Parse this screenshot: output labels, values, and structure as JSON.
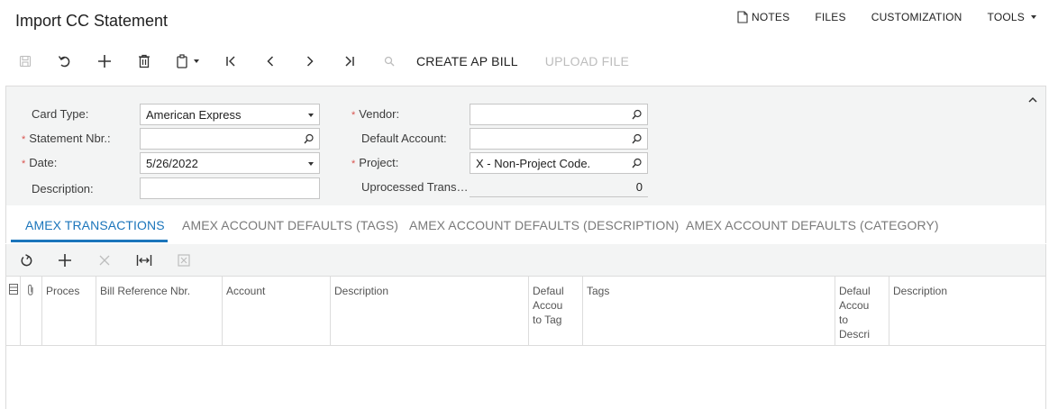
{
  "page": {
    "title": "Import CC Statement"
  },
  "top_menu": {
    "notes": "NOTES",
    "files": "FILES",
    "customization": "CUSTOMIZATION",
    "tools": "TOOLS"
  },
  "toolbar": {
    "icons": [
      "save-icon",
      "undo-icon",
      "add-icon",
      "delete-icon",
      "copy-paste-icon",
      "first-icon",
      "prev-icon",
      "next-icon",
      "last-icon",
      "search-icon"
    ],
    "create_ap_bill": "CREATE AP BILL",
    "upload_file": "UPLOAD FILE"
  },
  "form": {
    "card_type": {
      "label": "Card Type:",
      "value": "American Express"
    },
    "statement_nbr": {
      "label": "Statement Nbr.:",
      "value": ""
    },
    "date": {
      "label": "Date:",
      "value": "5/26/2022"
    },
    "description": {
      "label": "Description:",
      "value": ""
    },
    "vendor": {
      "label": "Vendor:",
      "value": ""
    },
    "default_account": {
      "label": "Default Account:",
      "value": ""
    },
    "project": {
      "label": "Project:",
      "value": "X - Non-Project Code."
    },
    "unprocessed": {
      "label": "Uprocessed Trans…",
      "value": "0"
    },
    "required_mark": "*"
  },
  "tabs": [
    {
      "label": "AMEX TRANSACTIONS",
      "active": true
    },
    {
      "label": "AMEX ACCOUNT DEFAULTS (TAGS)",
      "active": false
    },
    {
      "label": "AMEX ACCOUNT DEFAULTS (DESCRIPTION)",
      "active": false
    },
    {
      "label": "AMEX ACCOUNT DEFAULTS (CATEGORY)",
      "active": false
    }
  ],
  "grid_toolbar": {
    "icons": [
      "refresh-icon",
      "add-row-icon",
      "delete-row-icon",
      "fit-columns-icon",
      "export-excel-icon"
    ]
  },
  "grid": {
    "columns": [
      {
        "key": "row-selector-icon",
        "label": ""
      },
      {
        "key": "attachment-icon",
        "label": ""
      },
      {
        "key": "processed",
        "label": "Proces"
      },
      {
        "key": "bill-ref",
        "label": "Bill Reference Nbr."
      },
      {
        "key": "account",
        "label": "Account"
      },
      {
        "key": "description",
        "label": "Description"
      },
      {
        "key": "default-account-to-tag",
        "label": "Defaul Accou to Tag"
      },
      {
        "key": "tags",
        "label": "Tags"
      },
      {
        "key": "default-account-to-descr",
        "label": "Defaul Accou to Descri"
      },
      {
        "key": "description-2",
        "label": "Description"
      }
    ],
    "rows": []
  },
  "colors": {
    "accent": "#1b75bb",
    "required": "#d9534f",
    "disabled": "#bdbdbd"
  }
}
